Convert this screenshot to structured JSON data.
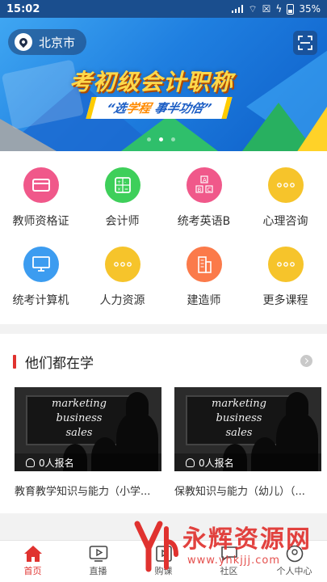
{
  "status_bar": {
    "time": "15:02",
    "battery": "35%"
  },
  "banner": {
    "location": "北京市",
    "headline": "考初级会计职称",
    "slogan_part1": "“选",
    "slogan_highlight": "学程",
    "slogan_part2": " 事半功倍”",
    "active_slide": 2,
    "slide_count": 3
  },
  "categories": [
    {
      "label": "教师资格证",
      "icon": "card-icon",
      "color": "#f0588a"
    },
    {
      "label": "会计师",
      "icon": "calculator-icon",
      "color": "#3ecf5a"
    },
    {
      "label": "统考英语B",
      "icon": "abc-icon",
      "color": "#f0588a"
    },
    {
      "label": "心理咨询",
      "icon": "more-dots-icon",
      "color": "#f6c42b"
    },
    {
      "label": "统考计算机",
      "icon": "monitor-icon",
      "color": "#3c9cf0"
    },
    {
      "label": "人力资源",
      "icon": "more-dots-icon",
      "color": "#f6c42b"
    },
    {
      "label": "建造师",
      "icon": "building-icon",
      "color": "#fb7a4a"
    },
    {
      "label": "更多课程",
      "icon": "more-dots-icon",
      "color": "#f6c42b"
    }
  ],
  "section": {
    "title": "他们都在学",
    "courses": [
      {
        "board_lines": [
          "marketing",
          "business",
          "sales"
        ],
        "enroll": "0人报名",
        "name": "教育教学知识与能力（小学..."
      },
      {
        "board_lines": [
          "marketing",
          "business",
          "sales"
        ],
        "enroll": "0人报名",
        "name": "保教知识与能力（幼儿）（..."
      }
    ]
  },
  "tabbar": {
    "items": [
      {
        "label": "首页",
        "icon": "home-icon",
        "active": true
      },
      {
        "label": "直播",
        "icon": "live-tv-icon",
        "active": false
      },
      {
        "label": "购课",
        "icon": "cart-icon",
        "active": false
      },
      {
        "label": "社区",
        "icon": "chat-icon",
        "active": false
      },
      {
        "label": "个人中心",
        "icon": "user-icon",
        "active": false
      }
    ]
  },
  "watermark": {
    "text": "永辉资源网",
    "url": "www.yhkjjj.com"
  }
}
